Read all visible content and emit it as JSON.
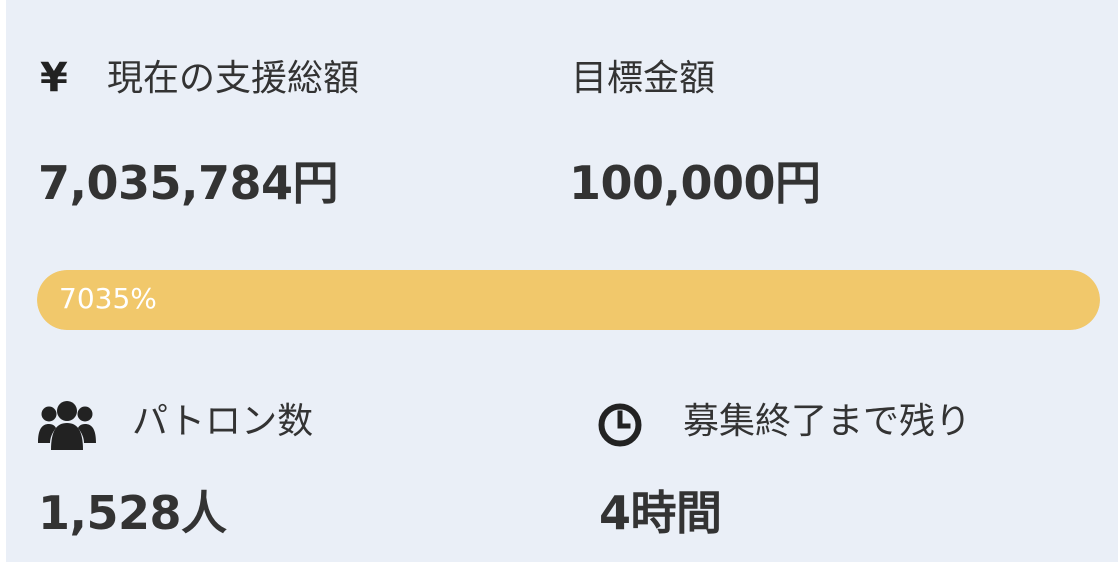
{
  "support": {
    "total_icon": "yen-icon",
    "total_label": "現在の支援総額",
    "total_value": "7,035,784円",
    "goal_label": "目標金額",
    "goal_value": "100,000円"
  },
  "progress": {
    "text": "7035%",
    "percent": 7035,
    "bar_fill_fraction": 1.0,
    "bar_color": "#f1c86b"
  },
  "stats": {
    "patrons_icon": "users-icon",
    "patrons_label": "パトロン数",
    "patrons_value": "1,528人",
    "remaining_icon": "clock-icon",
    "remaining_label": "募集終了まで残り",
    "remaining_value": "4時間"
  },
  "colors": {
    "panel_background": "#eaeff7",
    "text": "#333333",
    "progress_fill": "#f1c86b"
  }
}
